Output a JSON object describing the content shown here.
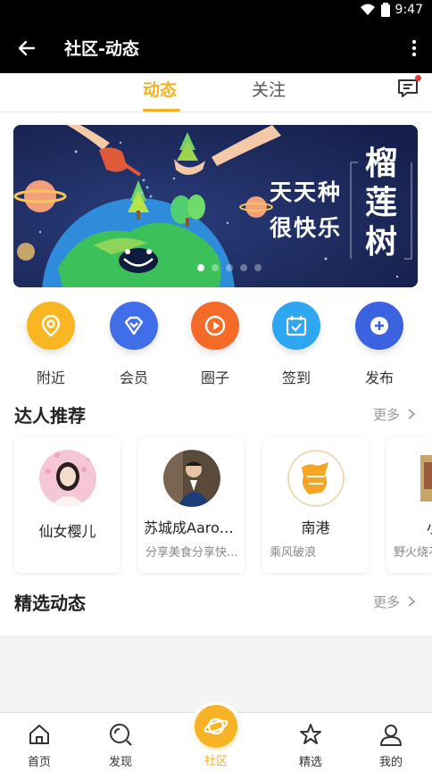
{
  "status_bar": {
    "time": "9:47"
  },
  "app_bar": {
    "title": "社区-动态"
  },
  "tabs": [
    {
      "label": "动态",
      "active": true
    },
    {
      "label": "关注",
      "active": false
    }
  ],
  "banner": {
    "slogan_line1": "天天种",
    "slogan_line2": "很快乐",
    "tree_name": "榴莲树",
    "page_indicator": {
      "count": 5,
      "active": 1
    }
  },
  "quick_actions": [
    {
      "label": "附近",
      "icon": "location-icon",
      "color": "#f8b722"
    },
    {
      "label": "会员",
      "icon": "diamond-icon",
      "color": "#3f6ee8"
    },
    {
      "label": "圈子",
      "icon": "play-icon",
      "color": "#f46a28"
    },
    {
      "label": "签到",
      "icon": "calendar-check-icon",
      "color": "#2ea6f0"
    },
    {
      "label": "发布",
      "icon": "plus-icon",
      "color": "#3b63e0"
    }
  ],
  "experts": {
    "title": "达人推荐",
    "more": "更多",
    "items": [
      {
        "name": "仙女樱儿",
        "desc": ""
      },
      {
        "name": "苏城成Aaron...",
        "desc": "分享美食分享快..."
      },
      {
        "name": "南港",
        "desc": "乘风破浪"
      },
      {
        "name": "小",
        "desc": "野火烧不"
      }
    ]
  },
  "featured": {
    "title": "精选动态",
    "more": "更多"
  },
  "bottom_nav": [
    {
      "label": "首页",
      "icon": "home-icon"
    },
    {
      "label": "发现",
      "icon": "discover-icon"
    },
    {
      "label": "社区",
      "icon": "community-planet-icon",
      "active": true
    },
    {
      "label": "精选",
      "icon": "star-icon"
    },
    {
      "label": "我的",
      "icon": "user-icon"
    }
  ],
  "colors": {
    "accent": "#f2b321",
    "app_bar": "#000000",
    "banner_bg": "#1c2a5e"
  }
}
